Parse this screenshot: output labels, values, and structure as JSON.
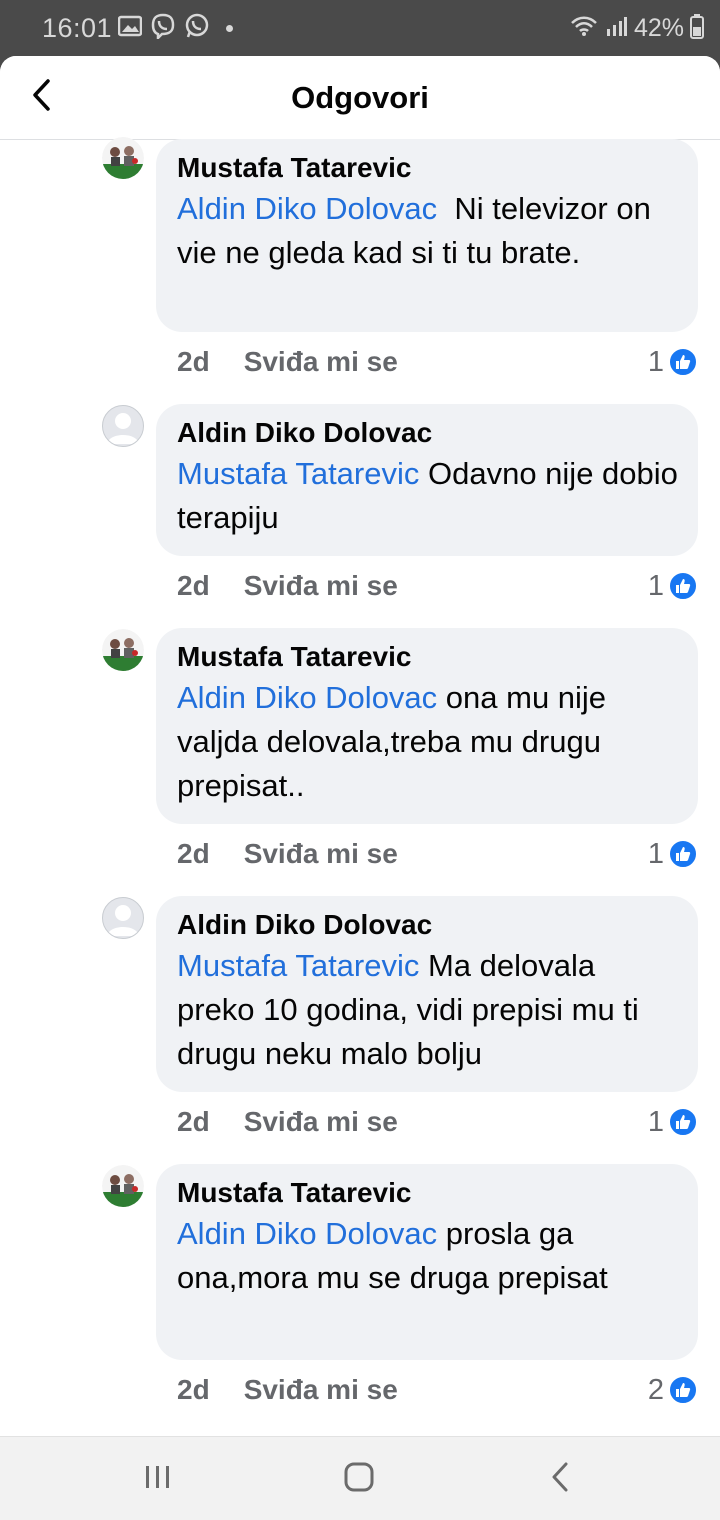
{
  "status_bar": {
    "time": "16:01",
    "battery": "42%",
    "icons_left": [
      "image-icon",
      "viber-icon",
      "whatsapp-icon"
    ],
    "icons_right": [
      "wifi-icon",
      "signal-icon",
      "battery-icon"
    ]
  },
  "header": {
    "title": "Odgovori",
    "back_icon": "chevron-left-icon"
  },
  "comments": [
    {
      "author": "Mustafa Tatarevic",
      "avatar": "photo",
      "mention": "Aldin Diko Dolovac",
      "text": "  Ni televizor on vie ne gleda kad si ti tu brate.",
      "time": "2d",
      "like_label": "Sviđa mi se",
      "reaction_count": "1"
    },
    {
      "author": "Aldin Diko Dolovac",
      "avatar": "default",
      "mention": "Mustafa Tatarevic",
      "text": " Odavno nije dobio terapiju",
      "time": "2d",
      "like_label": "Sviđa mi se",
      "reaction_count": "1"
    },
    {
      "author": "Mustafa Tatarevic",
      "avatar": "photo",
      "mention": "Aldin Diko Dolovac",
      "text": " ona mu nije valjda delovala,treba mu drugu prepisat..",
      "time": "2d",
      "like_label": "Sviđa mi se",
      "reaction_count": "1"
    },
    {
      "author": "Aldin Diko Dolovac",
      "avatar": "default",
      "mention": "Mustafa Tatarevic",
      "text": " Ma delovala preko 10 godina, vidi prepisi mu ti drugu neku malo bolju",
      "time": "2d",
      "like_label": "Sviđa mi se",
      "reaction_count": "1"
    },
    {
      "author": "Mustafa Tatarevic",
      "avatar": "photo",
      "mention": "Aldin Diko Dolovac",
      "text": " prosla ga ona,mora mu se druga prepisat",
      "time": "2d",
      "like_label": "Sviđa mi se",
      "reaction_count": "2"
    }
  ],
  "nav_bar": {
    "buttons": [
      "recent-apps-icon",
      "home-icon",
      "back-icon"
    ]
  },
  "colors": {
    "mention": "#216fdb",
    "bubble": "#f0f2f5",
    "like_blue": "#1877f2",
    "secondary_text": "#65676b"
  }
}
